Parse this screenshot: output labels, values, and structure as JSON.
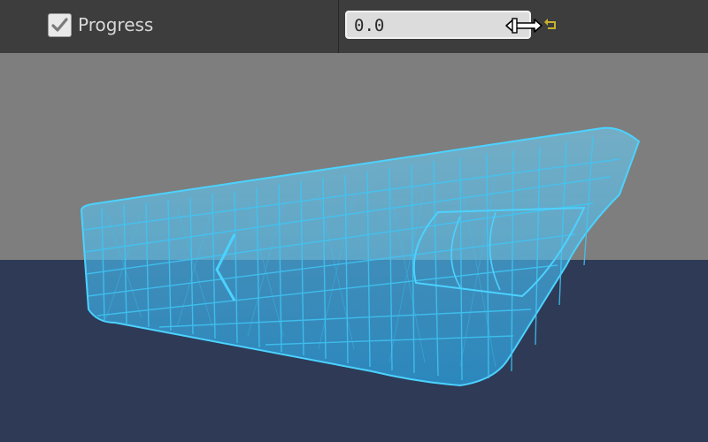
{
  "property": {
    "label": "Progress",
    "checked": true,
    "value": "0.0"
  },
  "icons": {
    "checkbox": "checkmark-icon",
    "drag": "horizontal-resize-cursor-icon",
    "reset": "reset-to-default-icon"
  },
  "colors": {
    "panel": "#3d3d3d",
    "sky": "#7e7e7e",
    "ground": "#2e3a56",
    "mesh": "#3fc6f5",
    "reset_arrow": "#c9b12b"
  }
}
